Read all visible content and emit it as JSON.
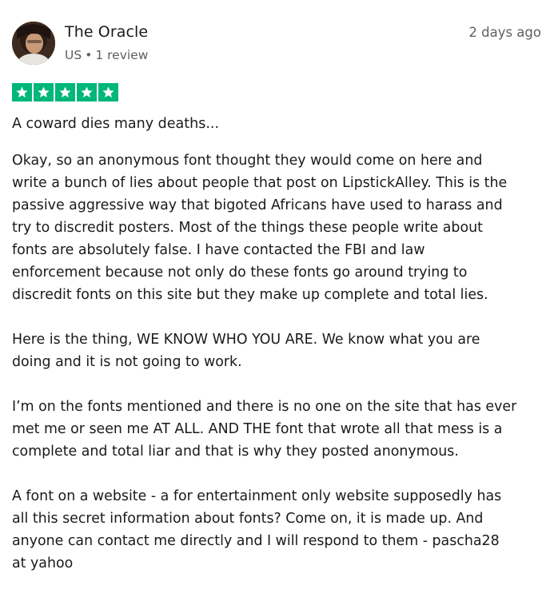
{
  "review": {
    "author": "The Oracle",
    "country": "US",
    "separator": "•",
    "review_count": "1 review",
    "date": "2 days ago",
    "rating": 5,
    "star_color": "#00b67a",
    "title": "A coward dies many deaths...",
    "paragraphs": [
      [
        "Okay, so an anonymous font thought they would come on here and",
        "write a bunch of lies about people that post on LipstickAlley. This is the",
        "passive aggressive way that bigoted Africans have used to harass and",
        "try to discredit posters. Most of the things these people write about",
        "fonts are absolutely false. I have contacted the FBI and law",
        "enforcement because not only do these fonts go around trying to",
        "discredit fonts on this site but they make up complete and total lies."
      ],
      [
        "Here is the thing, WE KNOW WHO YOU ARE. We know what you are",
        "doing and it is not going to work."
      ],
      [
        "I’m on the fonts mentioned and there is no one on the site that has ever",
        "met me or seen me AT ALL. AND THE font that wrote all that mess is a",
        "complete and total liar and that is why they posted anonymous."
      ],
      [
        "A font on a website - a for entertainment only website supposedly has",
        "all this secret information about fonts? Come on, it is made up. And",
        "anyone can contact me directly and I will respond to them - pascha28",
        "at yahoo"
      ]
    ]
  }
}
